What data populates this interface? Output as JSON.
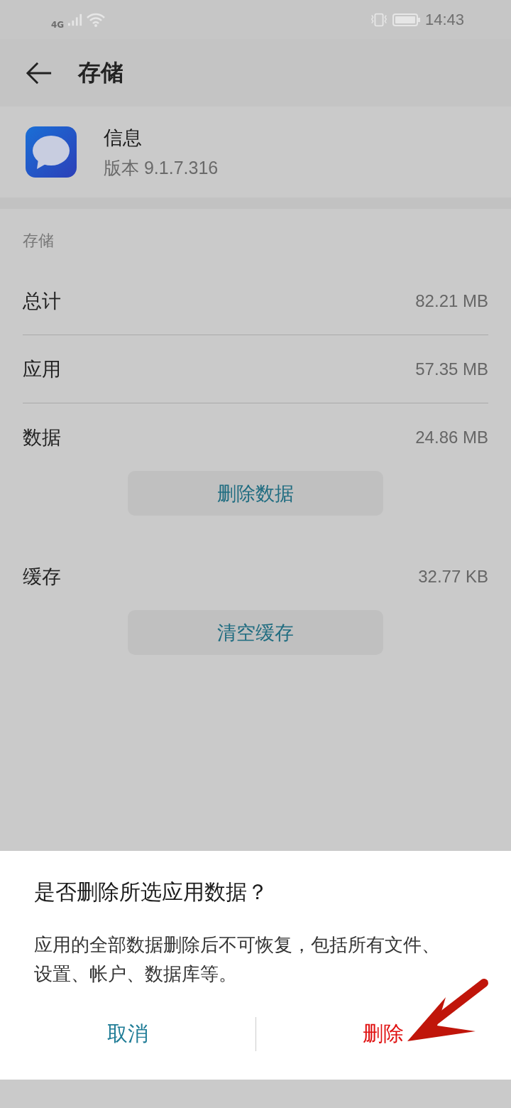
{
  "status_bar": {
    "network": "4G",
    "time": "14:43"
  },
  "header": {
    "title": "存储"
  },
  "app": {
    "name": "信息",
    "version": "版本 9.1.7.316"
  },
  "storage": {
    "section_title": "存储",
    "items": [
      {
        "kind": "row",
        "label": "总计",
        "value": "82.21 MB"
      },
      {
        "kind": "row",
        "label": "应用",
        "value": "57.35 MB"
      },
      {
        "kind": "row",
        "label": "数据",
        "value": "24.86 MB"
      },
      {
        "kind": "button",
        "label": "删除数据"
      },
      {
        "kind": "row",
        "label": "缓存",
        "value": "32.77 KB"
      },
      {
        "kind": "button",
        "label": "清空缓存"
      }
    ]
  },
  "dialog": {
    "title": "是否删除所选应用数据？",
    "message": "应用的全部数据删除后不可恢复，包括所有文件、设置、帐户、数据库等。",
    "buttons": [
      {
        "label": "取消",
        "kind": "neutral"
      },
      {
        "label": "删除",
        "kind": "destructive"
      }
    ]
  }
}
